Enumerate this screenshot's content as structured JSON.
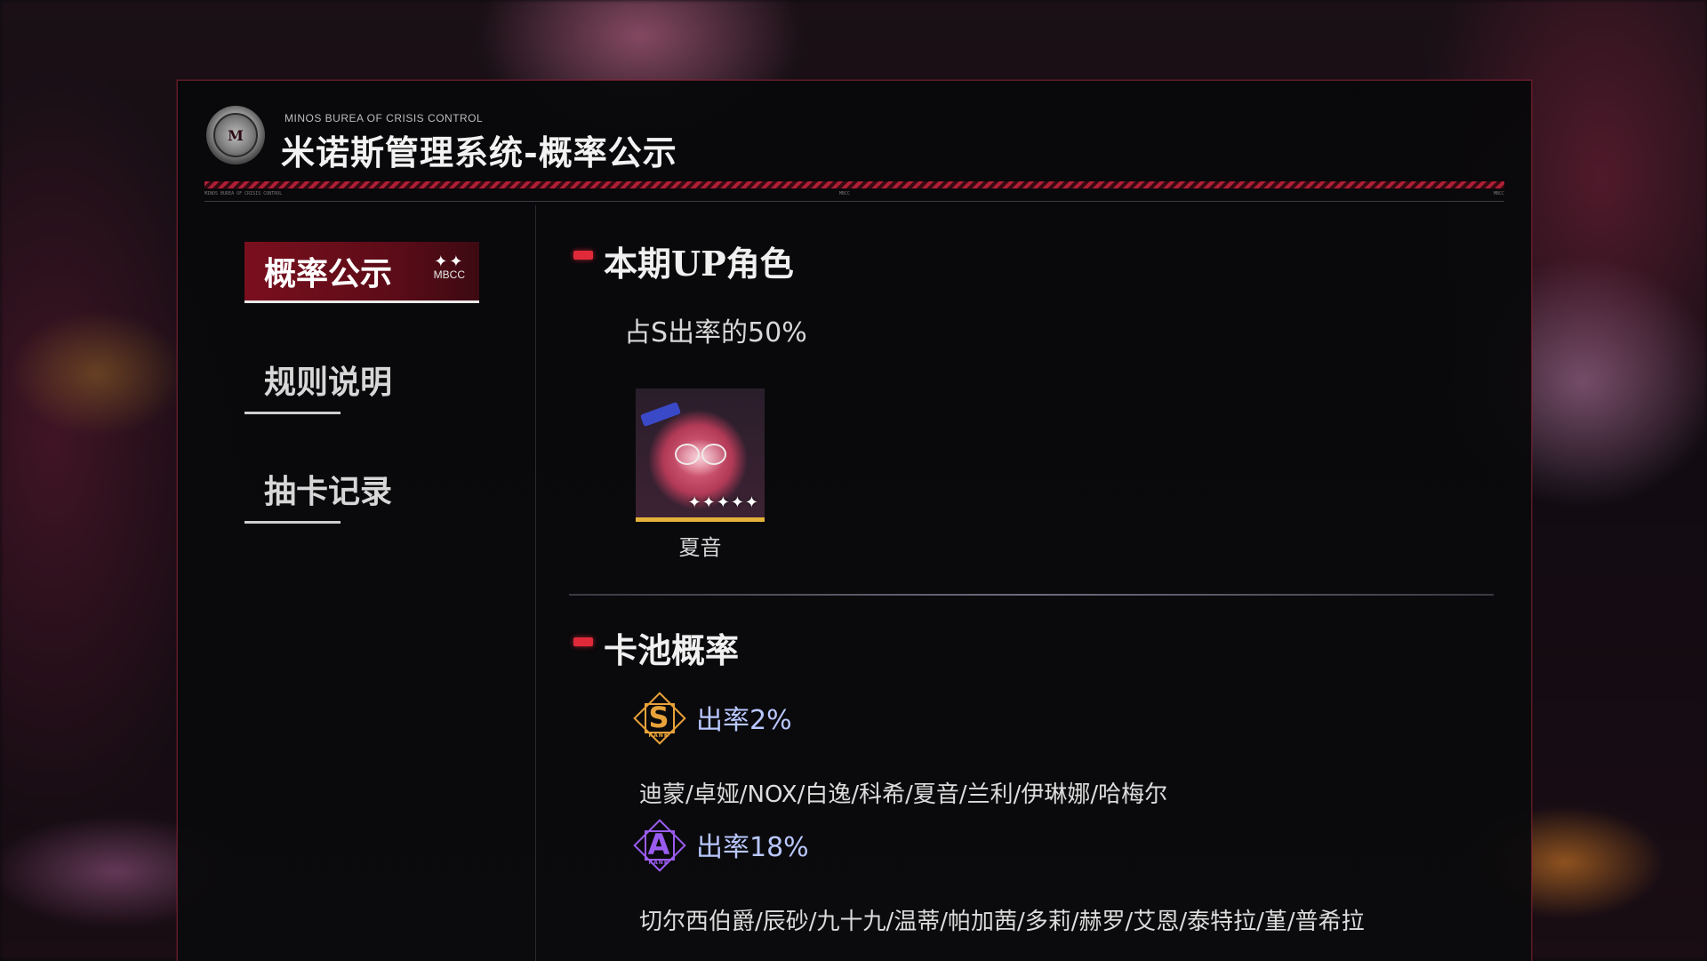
{
  "header": {
    "org_en": "MINOS BUREA OF CRISIS CONTROL",
    "title": "米诺斯管理系统-概率公示",
    "logo_text": "MBCC",
    "micro_left": "MINOS BUREA OF CRISIS CONTROL",
    "micro_mid": "MBCC",
    "micro_right": "MBCC"
  },
  "sidebar": {
    "items": [
      {
        "label": "概率公示",
        "tag": "MBCC",
        "sparkle": "✦✦",
        "active": true
      },
      {
        "label": "规则说明",
        "active": false
      },
      {
        "label": "抽卡记录",
        "active": false
      }
    ]
  },
  "up_section": {
    "title": "本期UP角色",
    "rate_text": "占S出率的50%",
    "character": {
      "name": "夏音",
      "stars": "✦✦✦✦✦"
    }
  },
  "pool_section": {
    "title": "卡池概率",
    "ranks": [
      {
        "letter": "S",
        "sub": "RANK",
        "rate": "出率2%",
        "characters": "迪蒙/卓娅/NOX/白逸/科希/夏音/兰利/伊琳娜/哈梅尔"
      },
      {
        "letter": "A",
        "sub": "RANK",
        "rate": "出率18%",
        "characters": "切尔西伯爵/辰砂/九十九/温蒂/帕加茜/多莉/赫罗/艾恩/泰特拉/堇/普希拉"
      }
    ]
  },
  "colors": {
    "accent_red": "#e02a3a",
    "rank_s": "#e8a23a",
    "rank_a": "#9a5cf0",
    "rate_text": "#b9c7ff",
    "card_border": "#e3b23a"
  }
}
